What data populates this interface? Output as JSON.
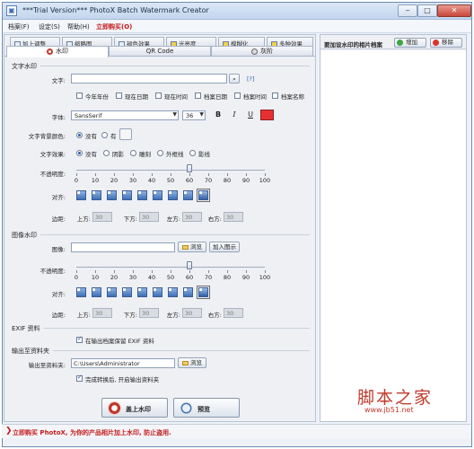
{
  "window": {
    "title": "***Trial Version*** PhotoX Batch Watermark Creator",
    "app_icon": "photo-app-icon",
    "controls": {
      "minimize": "‒",
      "maximize": "□",
      "close": "✕"
    }
  },
  "menu": [
    "档案(F)",
    "设定(S)",
    "帮助(H)",
    "立即购买(O)"
  ],
  "tabs_top": [
    {
      "label": "加上调整",
      "icon": "adjust-icon"
    },
    {
      "label": "缩略图",
      "icon": "thumbnail-icon"
    },
    {
      "label": "褪色效果",
      "icon": "fade-icon"
    },
    {
      "label": "光亮度",
      "icon": "brightness-icon"
    },
    {
      "label": "模糊化",
      "icon": "blur-icon"
    },
    {
      "label": "多种效果",
      "icon": "effects-icon"
    }
  ],
  "tabs_main": [
    {
      "label": "水印",
      "icon": "watermark-icon",
      "active": true
    },
    {
      "label": "QR Code",
      "icon": "",
      "active": false
    },
    {
      "label": "灰阶",
      "icon": "grayscale-icon",
      "active": false
    }
  ],
  "text_watermark": {
    "section": "文字水印",
    "text_label": "文字:",
    "text_value": "",
    "help": "[?]",
    "checks": [
      {
        "label": "今年年份",
        "checked": false
      },
      {
        "label": "现在日期",
        "checked": false
      },
      {
        "label": "现在时间",
        "checked": false
      },
      {
        "label": "档案日期",
        "checked": false
      },
      {
        "label": "档案时间",
        "checked": false
      },
      {
        "label": "档案名称",
        "checked": false
      }
    ],
    "font_label": "字体:",
    "font_value": "SansSerif",
    "size_value": "36",
    "bold": "B",
    "italic": "I",
    "underline": "U",
    "color": "#e83030",
    "bg_label": "文字背景颜色:",
    "bg_options": [
      "没有",
      "有"
    ],
    "effect_label": "文字效果:",
    "effect_options": [
      "没有",
      "阴影",
      "雕刻",
      "外框线",
      "影线"
    ],
    "opacity_label": "不透明度:",
    "opacity_value": 60,
    "ticks": [
      "0",
      "10",
      "20",
      "30",
      "40",
      "50",
      "60",
      "70",
      "80",
      "90",
      "100"
    ],
    "align_label": "对齐:",
    "margin_label": "边距:",
    "margins": [
      {
        "label": "上方:",
        "value": "30"
      },
      {
        "label": "下方:",
        "value": "30"
      },
      {
        "label": "左方:",
        "value": "30"
      },
      {
        "label": "右方:",
        "value": "30"
      }
    ]
  },
  "image_watermark": {
    "section": "图像水印",
    "image_label": "图像:",
    "image_value": "",
    "browse": "浏览",
    "add_icon": "加入图示",
    "opacity_label": "不透明度:",
    "opacity_value": 60,
    "ticks": [
      "0",
      "10",
      "20",
      "30",
      "40",
      "50",
      "60",
      "70",
      "80",
      "90",
      "100"
    ],
    "align_label": "对齐:",
    "margin_label": "边距:",
    "margins": [
      {
        "label": "上方:",
        "value": "30"
      },
      {
        "label": "下方:",
        "value": "30"
      },
      {
        "label": "左方:",
        "value": "30"
      },
      {
        "label": "右方:",
        "value": "30"
      }
    ]
  },
  "exif": {
    "section": "EXIF 资料",
    "keep_label": "在输出档案保留 EXIF 资料",
    "keep_checked": true
  },
  "output": {
    "section": "输出至资料夹",
    "folder_label": "输出至资料夹:",
    "folder_value": "C:\\Users\\Administrator",
    "browse": "浏览",
    "open_after_label": "完成转换后, 开启输出资料夹",
    "open_after_checked": true
  },
  "actions": {
    "apply": "盖上水印",
    "preview": "预览"
  },
  "file_panel": {
    "title": "要加设水印的相片档案",
    "add": "增加",
    "remove": "移除"
  },
  "watermark_overlay": {
    "line1": "脚本之家",
    "line2": "www.jb51.net"
  },
  "status": {
    "text": "立即购买 PhotoX, 为你的产品相片加上水印, 防止盗用."
  },
  "colors": {
    "accent": "#2b5ea8",
    "buy_red": "#c41a1a"
  }
}
